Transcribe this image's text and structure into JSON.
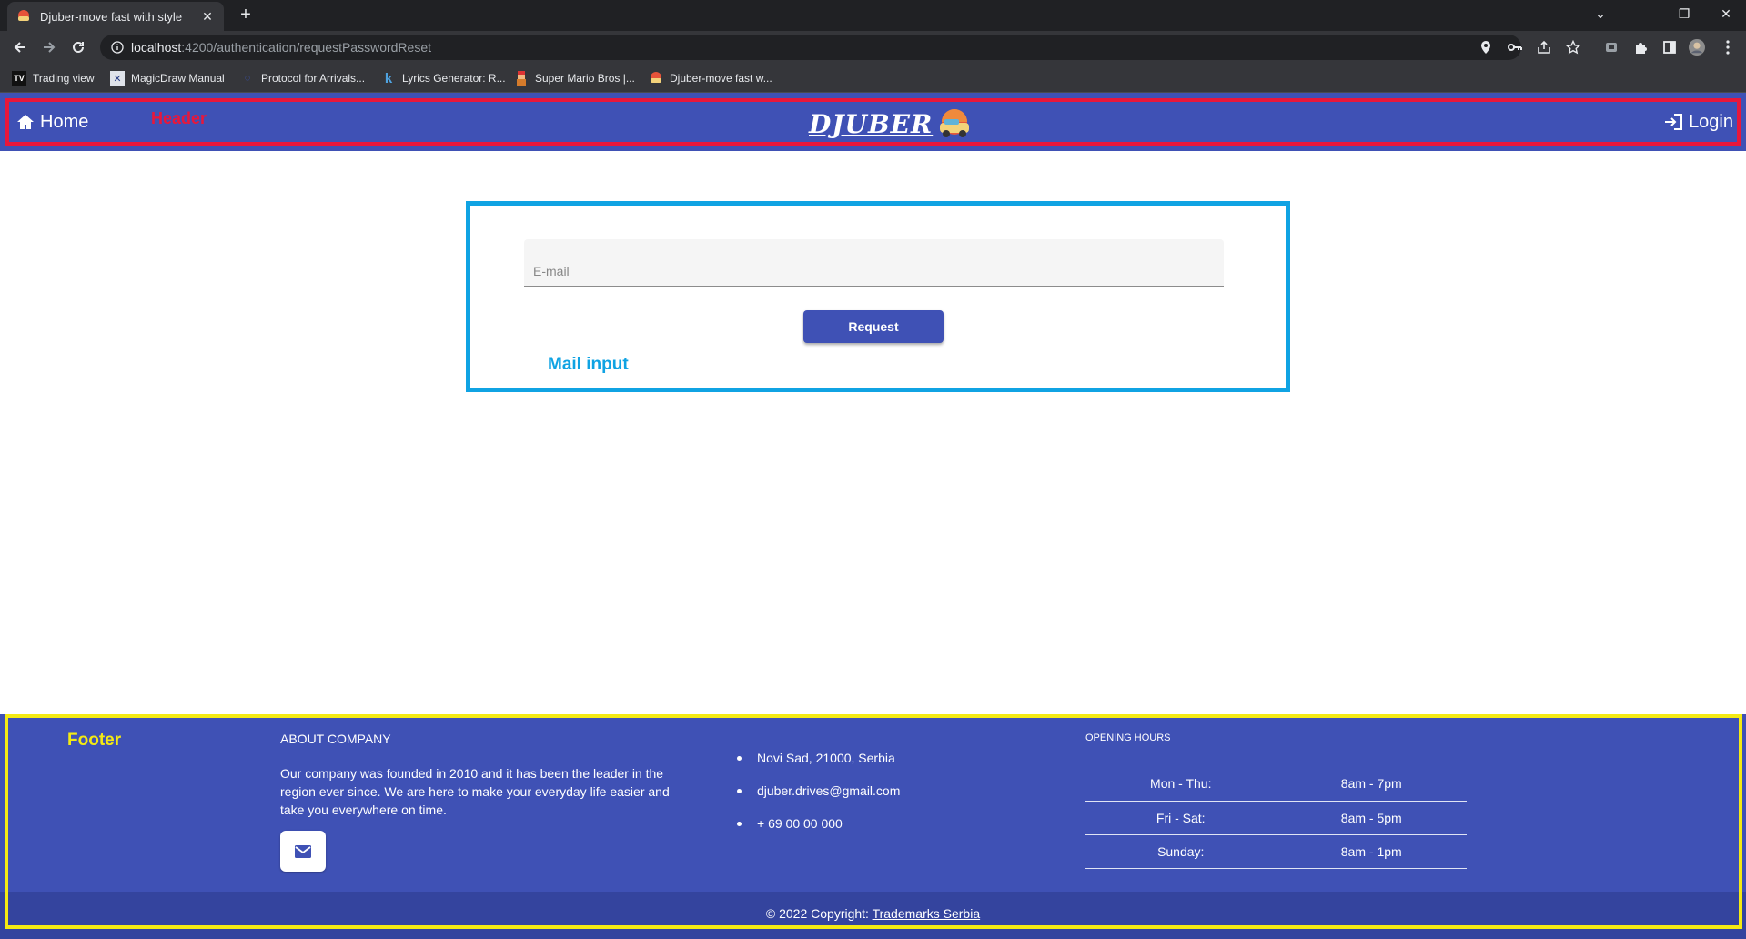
{
  "browser": {
    "tab_title": "Djuber-move fast with style",
    "url_host": "localhost",
    "url_rest": ":4200/authentication/requestPasswordReset",
    "bookmarks": [
      "Trading view",
      "MagicDraw Manual",
      "Protocol for Arrivals...",
      "Lyrics Generator: R...",
      "Super Mario Bros |...",
      "Djuber-move fast w..."
    ]
  },
  "header": {
    "home_label": "Home",
    "annotation": "Header",
    "logo_text": "DJUBER",
    "login_label": "Login"
  },
  "reset_form": {
    "email_placeholder": "E-mail",
    "request_label": "Request",
    "annotation": "Mail input"
  },
  "footer": {
    "annotation": "Footer",
    "about_title": "ABOUT COMPANY",
    "about_text": "Our company was founded in 2010 and it has been the leader in the region ever since. We are here to make your everyday life easier and take you everywhere on time.",
    "contacts": [
      "Novi Sad, 21000, Serbia",
      "djuber.drives@gmail.com",
      "+ 69 00 00 000"
    ],
    "hours_title": "OPENING HOURS",
    "hours": [
      {
        "day": "Mon - Thu:",
        "time": "8am - 7pm"
      },
      {
        "day": "Fri - Sat:",
        "time": "8am - 5pm"
      },
      {
        "day": "Sunday:",
        "time": "8am - 1pm"
      }
    ],
    "copyright_prefix": "© 2022 Copyright:",
    "copyright_link": "Trademarks Serbia"
  },
  "colors": {
    "primary": "#3f51b5",
    "header_outline": "#e8173b",
    "card_outline": "#10a3e3",
    "footer_outline": "#f4ea13"
  }
}
